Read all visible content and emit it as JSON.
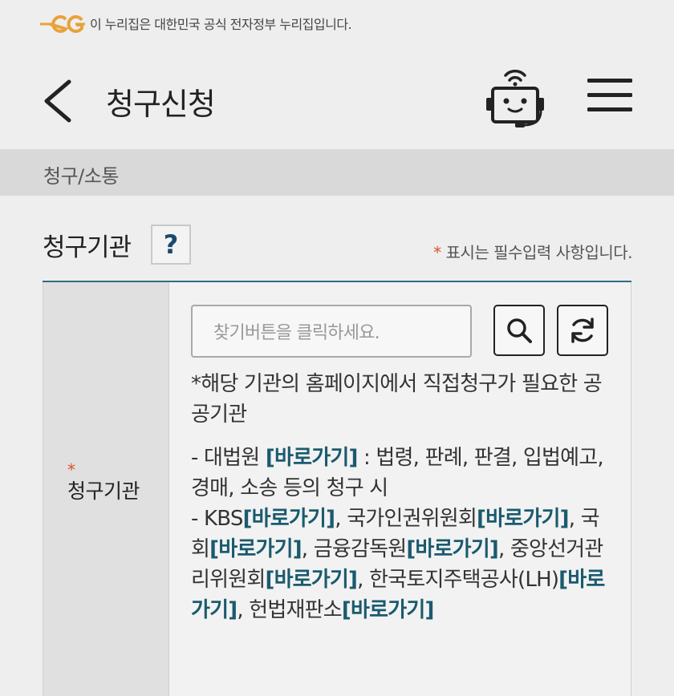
{
  "gov_banner": {
    "text": "이 누리집은 대한민국 공식 전자정부 누리집입니다."
  },
  "header": {
    "title": "청구신청"
  },
  "breadcrumb": {
    "text": "청구/소통"
  },
  "section": {
    "title": "청구기관",
    "help_label": "?",
    "required_star": "*",
    "required_note": "표시는 필수입력 사항입니다."
  },
  "form": {
    "field_star": "*",
    "field_label": "청구기관",
    "search_placeholder": "찾기버튼을 클릭하세요.",
    "info_intro": "*해당 기관의 홈페이지에서 직접청구가 필요한 공공기관",
    "link_label": "[바로가기]",
    "items": [
      {
        "prefix": " - ",
        "name": "대법원 ",
        "suffix": " : 법령, 판례, 판결, 입법예고, 경매, 소송 등의 청구 시"
      },
      {
        "prefix": " - ",
        "name": "KBS",
        "suffix": ", "
      },
      {
        "name": "국가인권위원회",
        "suffix": ", "
      },
      {
        "name": "국회",
        "suffix": ", "
      },
      {
        "name": "금융감독원",
        "suffix": ", "
      },
      {
        "name": "중앙선거관리위원회",
        "suffix": ", "
      },
      {
        "name": "한국토지주택공사(LH)",
        "suffix": ", "
      },
      {
        "name": "헌법재판소",
        "suffix": ""
      }
    ]
  },
  "colors": {
    "accent": "#2f6f7f",
    "link": "#1a5a6e",
    "required": "#d9531e",
    "logo": "#e8a23a"
  }
}
